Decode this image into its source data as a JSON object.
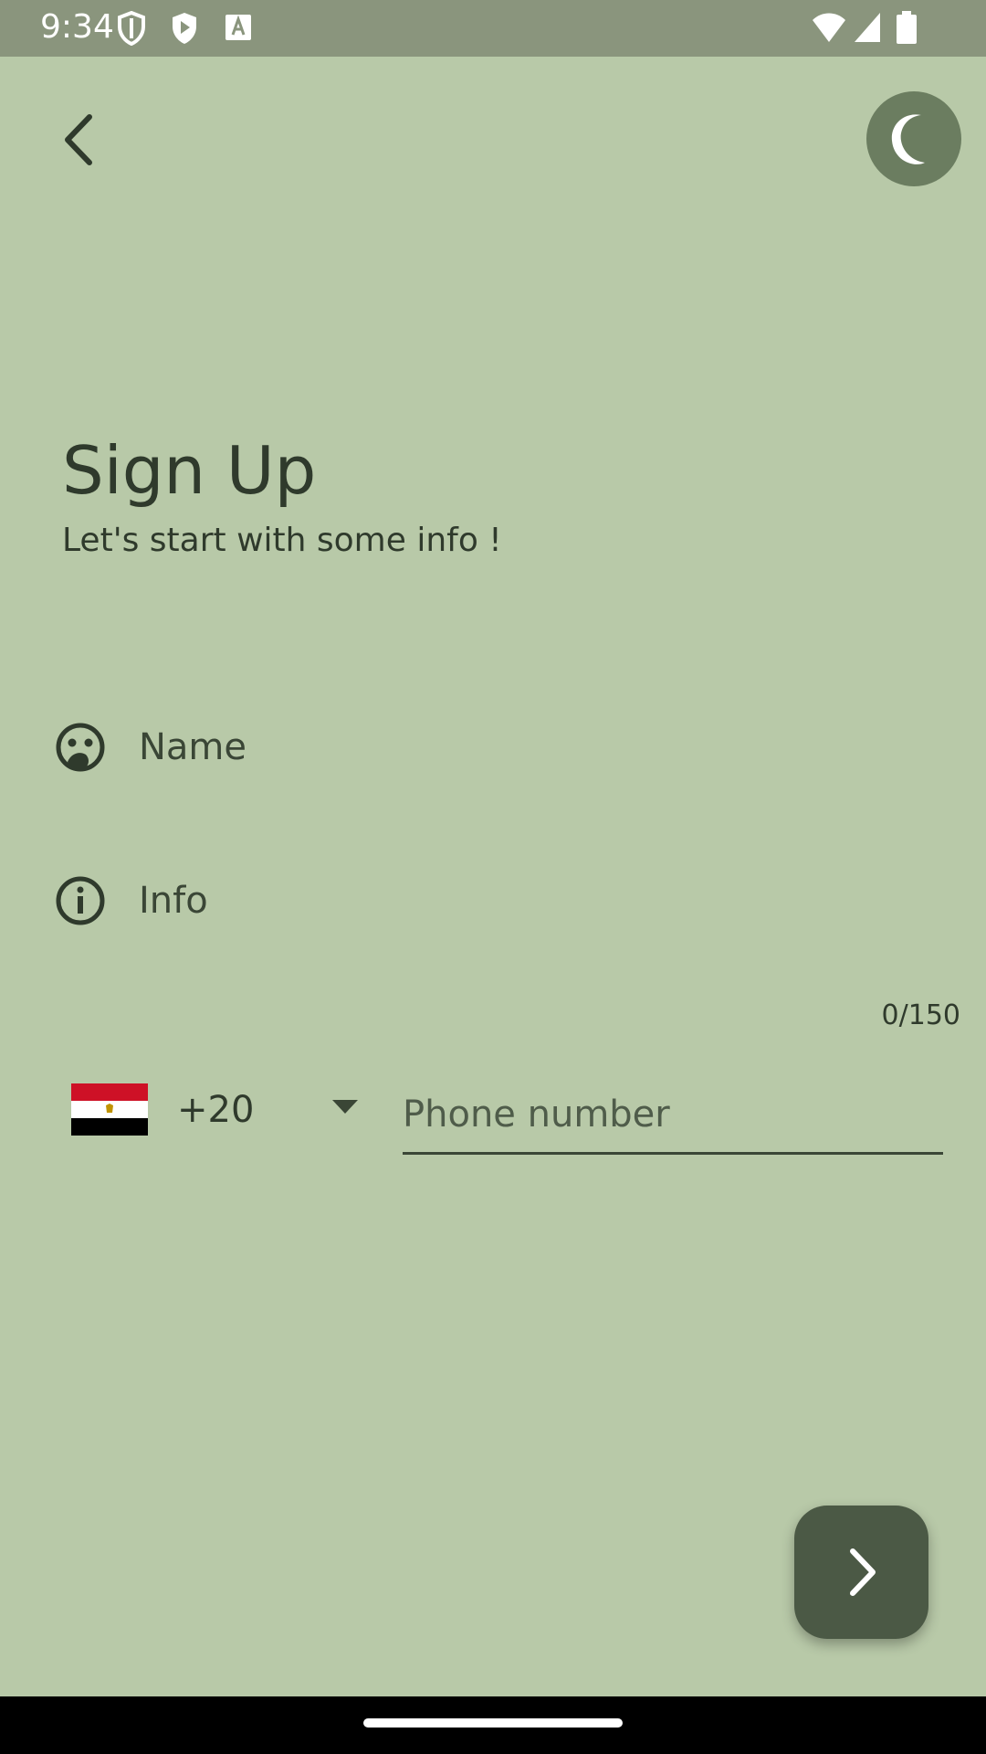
{
  "status_bar": {
    "time": "9:34",
    "left_icons": [
      "shield-icon",
      "play-protect-icon",
      "keyboard-a-icon"
    ],
    "right_icons": [
      "wifi-icon",
      "signal-icon",
      "battery-icon"
    ]
  },
  "header": {
    "back_icon": "chevron-left-icon",
    "theme_icon": "moon-icon"
  },
  "main": {
    "title": "Sign Up",
    "subtitle": "Let's start with some info !"
  },
  "form": {
    "name": {
      "placeholder": "Name",
      "value": "",
      "icon": "face-icon"
    },
    "info": {
      "placeholder": "Info",
      "value": "",
      "icon": "info-icon",
      "counter": "0/150"
    },
    "country": {
      "dial_code": "+20",
      "flag_icon": "egypt-flag-icon"
    },
    "phone": {
      "placeholder": "Phone number",
      "value": ""
    }
  },
  "next_button": {
    "icon": "chevron-right-icon"
  },
  "colors": {
    "background": "#b8c9a8",
    "status_bar": "#8a957d",
    "accent_dark": "#4b5945",
    "toggle": "#6b7d60",
    "text": "#2f3a2c"
  }
}
